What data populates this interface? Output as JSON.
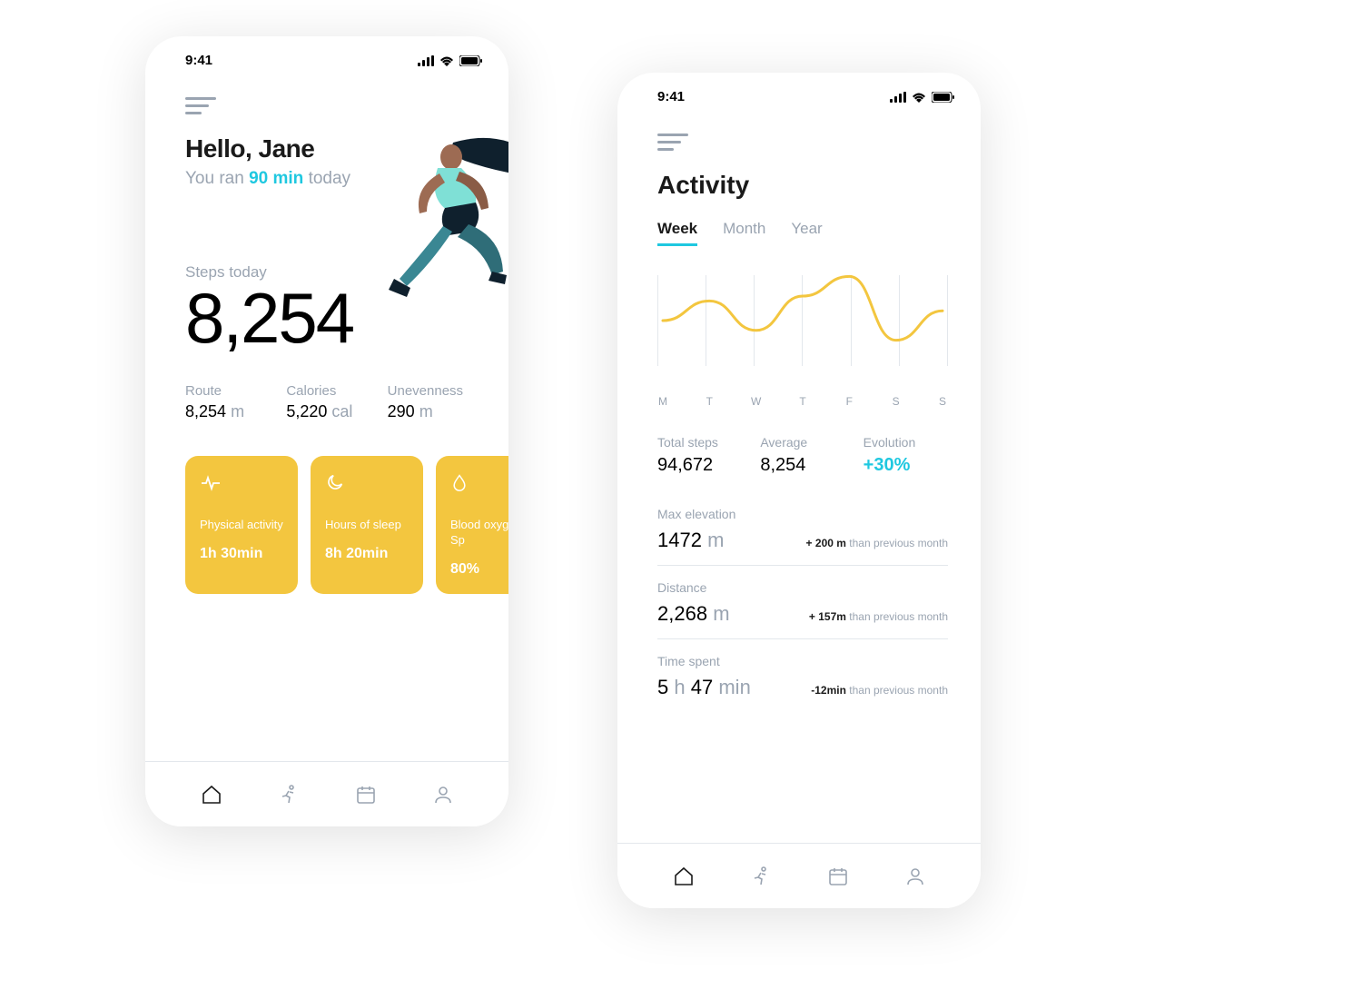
{
  "status": {
    "time": "9:41"
  },
  "colors": {
    "accent_yellow": "#F3C63F",
    "accent_cyan": "#1fc8e0",
    "text_muted": "#9aa4b1"
  },
  "home": {
    "greeting": "Hello, Jane",
    "sub_pre": "You ran ",
    "sub_highlight": "90 min",
    "sub_post": " today",
    "steps_label": "Steps today",
    "steps_value": "8,254",
    "metrics": {
      "route": {
        "label": "Route",
        "value": "8,254",
        "unit": "m"
      },
      "calories": {
        "label": "Calories",
        "value": "5,220",
        "unit": "cal"
      },
      "unevenness": {
        "label": "Unevenness",
        "value": "290",
        "unit": "m"
      }
    },
    "cards": {
      "physical": {
        "title": "Physical activity",
        "value": "1h 30min"
      },
      "sleep": {
        "title": "Hours of sleep",
        "value": "8h 20min"
      },
      "oxygen": {
        "title": "Blood oxygen Sp",
        "value": "80%"
      }
    }
  },
  "activity": {
    "title": "Activity",
    "tabs": {
      "week": "Week",
      "month": "Month",
      "year": "Year"
    },
    "summary": {
      "total": {
        "label": "Total steps",
        "value": "94,672"
      },
      "average": {
        "label": "Average",
        "value": "8,254"
      },
      "evolution": {
        "label": "Evolution",
        "value": "+30%"
      }
    },
    "stats": {
      "elevation": {
        "label": "Max elevation",
        "value": "1472",
        "unit": "m",
        "delta": "+ 200 m",
        "compare": " than previous month"
      },
      "distance": {
        "label": "Distance",
        "value": "2,268",
        "unit": "m",
        "delta": "+ 157m",
        "compare": " than previous month"
      },
      "time": {
        "label": "Time spent",
        "value_h": "5",
        "h_unit": "h",
        "value_m": "47",
        "m_unit": "min",
        "delta": "-12min",
        "compare": " than previous month"
      }
    }
  },
  "chart_data": {
    "type": "line",
    "categories": [
      "M",
      "T",
      "W",
      "T",
      "F",
      "S",
      "S"
    ],
    "values": [
      50,
      70,
      40,
      75,
      95,
      30,
      60
    ],
    "ylim": [
      0,
      100
    ],
    "title": "Activity",
    "xlabel": "",
    "ylabel": ""
  }
}
